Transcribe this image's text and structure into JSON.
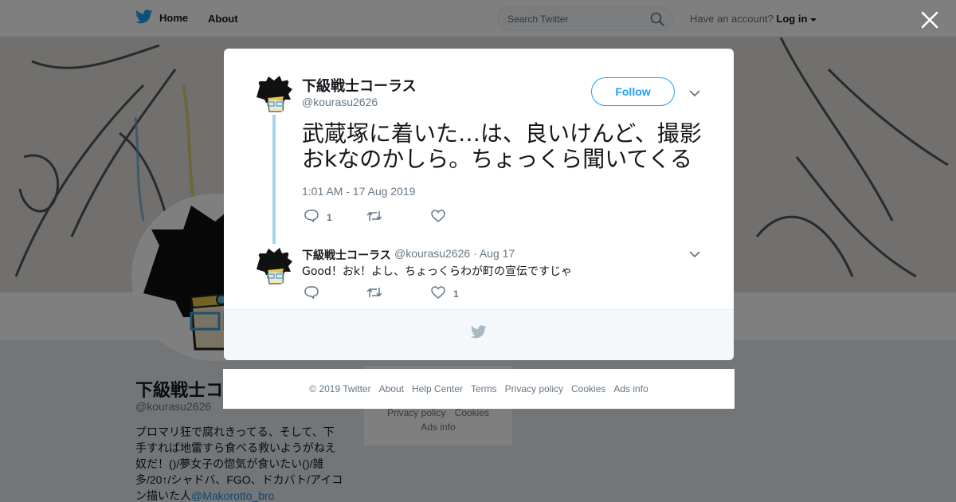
{
  "nav": {
    "home_label": "Home",
    "about_label": "About",
    "search_placeholder": "Search Twitter",
    "account_prompt": "Have an account?",
    "login_label": "Log in"
  },
  "profile": {
    "name": "下級戦士コーラス",
    "handle": "@kourasu2626",
    "bio_text": "プロマリ狂で腐れきってる、そして、下手すれば地雷すら食べる救いようがねえ奴だ！()/夢女子の惚気が食いたい()/雑多/20↑/シャドバ、FGO、ドカバト/アイコン描いた人",
    "bio_link": "@Makorotto_bro"
  },
  "side_card": {
    "links_row1": [
      "Privacy policy",
      "Cookies"
    ],
    "links_row2": [
      "Ads info"
    ]
  },
  "tweet": {
    "author_name": "下級戦士コーラス",
    "author_handle": "@kourasu2626",
    "follow_label": "Follow",
    "text": "武蔵塚に着いた…は、良いけんど、撮影おkなのかしら。ちょっくら聞いてくる",
    "timestamp": "1:01 AM - 17 Aug 2019",
    "reply_count": "1",
    "retweet_count": "",
    "like_count": ""
  },
  "reply": {
    "author_name": "下級戦士コーラス",
    "author_handle": "@kourasu2626",
    "date": "· Aug 17",
    "text": "Good！おk！よし、ちょっくらわが町の宣伝ですじゃ",
    "reply_count": "",
    "retweet_count": "",
    "like_count": "1"
  },
  "footer": {
    "links": [
      "© 2019 Twitter",
      "About",
      "Help Center",
      "Terms",
      "Privacy policy",
      "Cookies",
      "Ads info"
    ]
  },
  "colors": {
    "brand_blue": "#1da1f2",
    "thread_line": "#a5d4f2",
    "secondary_text": "#657786"
  }
}
